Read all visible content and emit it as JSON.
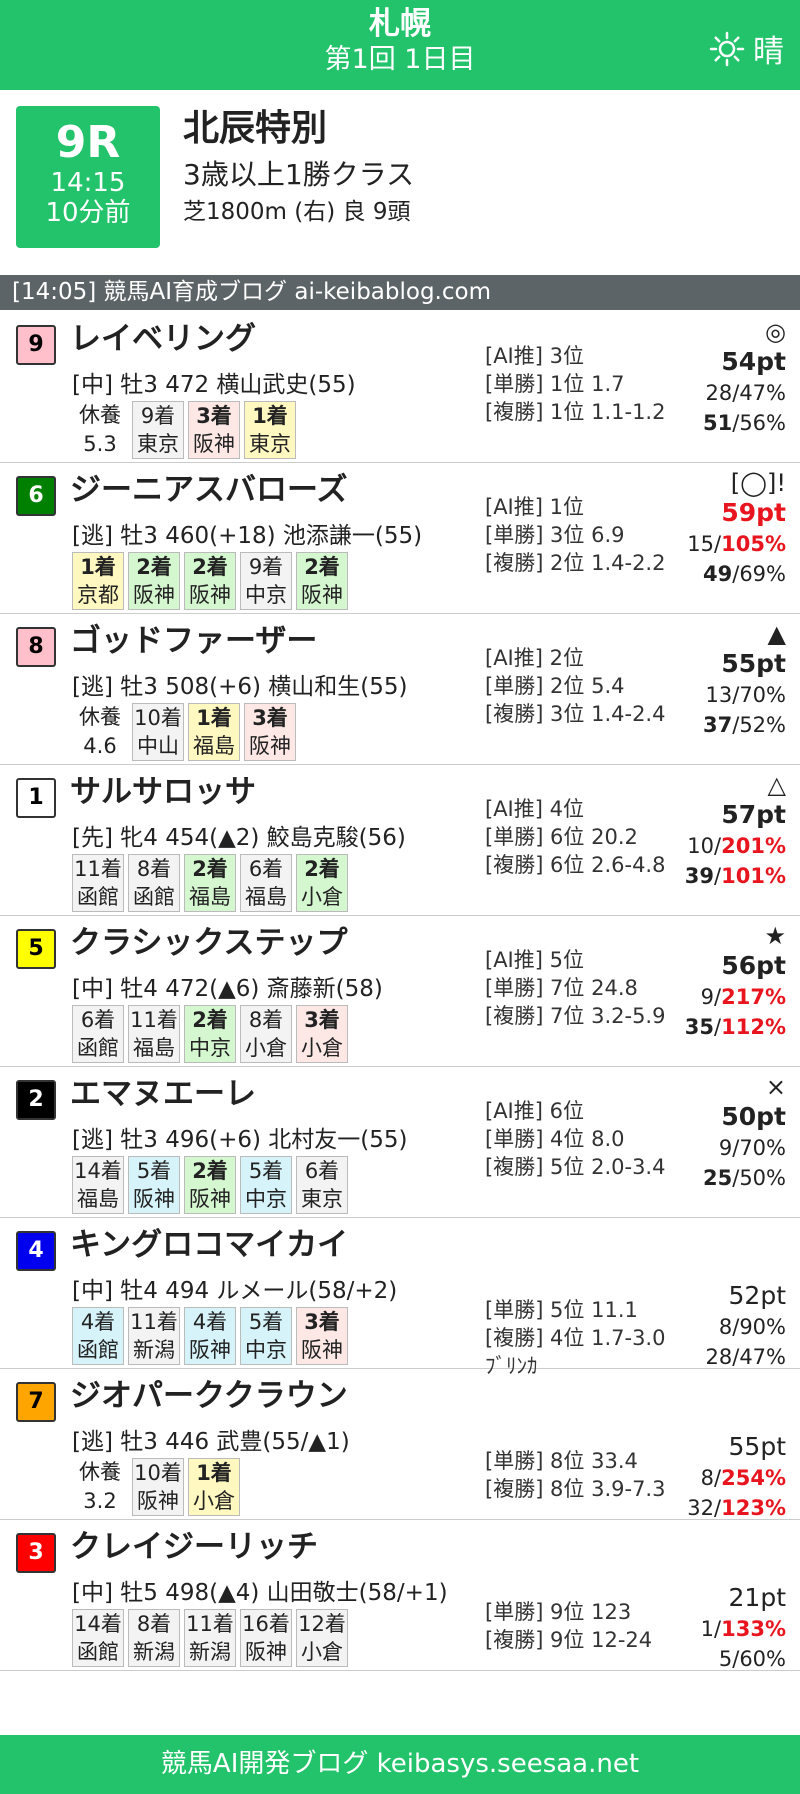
{
  "header": {
    "venue": "札幌",
    "day": "第1回 1日目",
    "weather": "晴",
    "weather_icon": "sun-icon"
  },
  "race": {
    "number": "9R",
    "time": "14:15",
    "until": "10分前",
    "name": "北辰特別",
    "class": "3歳以上1勝クラス",
    "course": "芝1800m (右) 良 9頭"
  },
  "source_bar": "[14:05] 競馬AI育成ブログ ai-keibablog.com",
  "horses": [
    {
      "num": "9",
      "name": "レイベリング",
      "info": "[中] 牡3 472 横山武史(55)",
      "rest": [
        "休養",
        "5.3"
      ],
      "history": [
        {
          "p": "9着",
          "t": "東京",
          "c": "plain"
        },
        {
          "p": "3着",
          "t": "阪神",
          "c": "bronze"
        },
        {
          "p": "1着",
          "t": "東京",
          "c": "gold"
        }
      ],
      "odds": [
        "[AI推] 3位",
        "[単勝] 1位 1.7",
        "[複勝] 1位 1.1-1.2"
      ],
      "mark": "◎",
      "pts": "54pt",
      "win_rate": "28/47%",
      "place_rate": "51/56%"
    },
    {
      "num": "6",
      "name": "ジーニアスバローズ",
      "info": "[逃] 牡3 460(+18) 池添謙一(55)",
      "rest": [],
      "history": [
        {
          "p": "1着",
          "t": "京都",
          "c": "gold"
        },
        {
          "p": "2着",
          "t": "阪神",
          "c": "silver"
        },
        {
          "p": "2着",
          "t": "阪神",
          "c": "silver"
        },
        {
          "p": "9着",
          "t": "中京",
          "c": "plain"
        },
        {
          "p": "2着",
          "t": "阪神",
          "c": "silver"
        }
      ],
      "odds": [
        "[AI推] 1位",
        "[単勝] 3位 6.9",
        "[複勝] 2位 1.4-2.2"
      ],
      "mark": "[◯]!",
      "pts": "59pt",
      "win_rate": "15/105%",
      "place_rate": "49/69%"
    },
    {
      "num": "8",
      "name": "ゴッドファーザー",
      "info": "[逃] 牡3 508(+6) 横山和生(55)",
      "rest": [
        "休養",
        "4.6"
      ],
      "history": [
        {
          "p": "10着",
          "t": "中山",
          "c": "plain"
        },
        {
          "p": "1着",
          "t": "福島",
          "c": "gold"
        },
        {
          "p": "3着",
          "t": "阪神",
          "c": "bronze"
        }
      ],
      "odds": [
        "[AI推] 2位",
        "[単勝] 2位 5.4",
        "[複勝] 3位 1.4-2.4"
      ],
      "mark": "▲",
      "pts": "55pt",
      "win_rate": "13/70%",
      "place_rate": "37/52%"
    },
    {
      "num": "1",
      "name": "サルサロッサ",
      "info": "[先] 牝4 454(▲2) 鮫島克駿(56)",
      "rest": [],
      "history": [
        {
          "p": "11着",
          "t": "函館",
          "c": "plain"
        },
        {
          "p": "8着",
          "t": "函館",
          "c": "plain"
        },
        {
          "p": "2着",
          "t": "福島",
          "c": "silver"
        },
        {
          "p": "6着",
          "t": "福島",
          "c": "plain"
        },
        {
          "p": "2着",
          "t": "小倉",
          "c": "silver"
        }
      ],
      "odds": [
        "[AI推] 4位",
        "[単勝] 6位 20.2",
        "[複勝] 6位 2.6-4.8"
      ],
      "mark": "△",
      "pts": "57pt",
      "win_rate": "10/201%",
      "place_rate": "39/101%"
    },
    {
      "num": "5",
      "name": "クラシックステップ",
      "info": "[中] 牡4 472(▲6) 斎藤新(58)",
      "rest": [],
      "history": [
        {
          "p": "6着",
          "t": "函館",
          "c": "plain"
        },
        {
          "p": "11着",
          "t": "福島",
          "c": "plain"
        },
        {
          "p": "2着",
          "t": "中京",
          "c": "silver"
        },
        {
          "p": "8着",
          "t": "小倉",
          "c": "plain"
        },
        {
          "p": "3着",
          "t": "小倉",
          "c": "bronze"
        }
      ],
      "odds": [
        "[AI推] 5位",
        "[単勝] 7位 24.8",
        "[複勝] 7位 3.2-5.9"
      ],
      "mark": "★",
      "pts": "56pt",
      "win_rate": "9/217%",
      "place_rate": "35/112%"
    },
    {
      "num": "2",
      "name": "エマヌエーレ",
      "info": "[逃] 牡3 496(+6) 北村友一(55)",
      "rest": [],
      "history": [
        {
          "p": "14着",
          "t": "福島",
          "c": "plain"
        },
        {
          "p": "5着",
          "t": "阪神",
          "c": "blue"
        },
        {
          "p": "2着",
          "t": "阪神",
          "c": "silver"
        },
        {
          "p": "5着",
          "t": "中京",
          "c": "blue"
        },
        {
          "p": "6着",
          "t": "東京",
          "c": "plain"
        }
      ],
      "odds": [
        "[AI推] 6位",
        "[単勝] 4位 8.0",
        "[複勝] 5位 2.0-3.4"
      ],
      "mark": "×",
      "pts": "50pt",
      "win_rate": "9/70%",
      "place_rate": "25/50%"
    },
    {
      "num": "4",
      "name": "キングロコマイカイ",
      "info": "[中] 牡4 494 ルメール(58/+2)",
      "rest": [],
      "history": [
        {
          "p": "4着",
          "t": "函館",
          "c": "blue"
        },
        {
          "p": "11着",
          "t": "新潟",
          "c": "plain"
        },
        {
          "p": "4着",
          "t": "阪神",
          "c": "blue"
        },
        {
          "p": "5着",
          "t": "中京",
          "c": "blue"
        },
        {
          "p": "3着",
          "t": "阪神",
          "c": "bronze"
        }
      ],
      "odds": [
        "",
        "[単勝] 5位 11.1",
        "[複勝] 4位 1.7-3.0",
        "ﾌﾞﾘﾝｶ"
      ],
      "mark": "",
      "pts": "52pt",
      "win_rate": "8/90%",
      "place_rate": "28/47%"
    },
    {
      "num": "7",
      "name": "ジオパーククラウン",
      "info": "[逃] 牡3 446 武豊(55/▲1)",
      "rest": [
        "休養",
        "3.2"
      ],
      "history": [
        {
          "p": "10着",
          "t": "阪神",
          "c": "plain"
        },
        {
          "p": "1着",
          "t": "小倉",
          "c": "gold"
        }
      ],
      "odds": [
        "",
        "[単勝] 8位 33.4",
        "[複勝] 8位 3.9-7.3"
      ],
      "mark": "",
      "pts": "55pt",
      "win_rate": "8/254%",
      "place_rate": "32/123%"
    },
    {
      "num": "3",
      "name": "クレイジーリッチ",
      "info": "[中] 牡5 498(▲4) 山田敬士(58/+1)",
      "rest": [],
      "history": [
        {
          "p": "14着",
          "t": "函館",
          "c": "plain"
        },
        {
          "p": "8着",
          "t": "新潟",
          "c": "plain"
        },
        {
          "p": "11着",
          "t": "新潟",
          "c": "plain"
        },
        {
          "p": "16着",
          "t": "阪神",
          "c": "plain"
        },
        {
          "p": "12着",
          "t": "小倉",
          "c": "plain"
        }
      ],
      "odds": [
        "",
        "[単勝] 9位 123",
        "[複勝] 9位 12-24"
      ],
      "mark": "",
      "pts": "21pt",
      "win_rate": "1/133%",
      "place_rate": "5/60%"
    }
  ],
  "footer": "競馬AI開発ブログ keibasys.seesaa.net"
}
